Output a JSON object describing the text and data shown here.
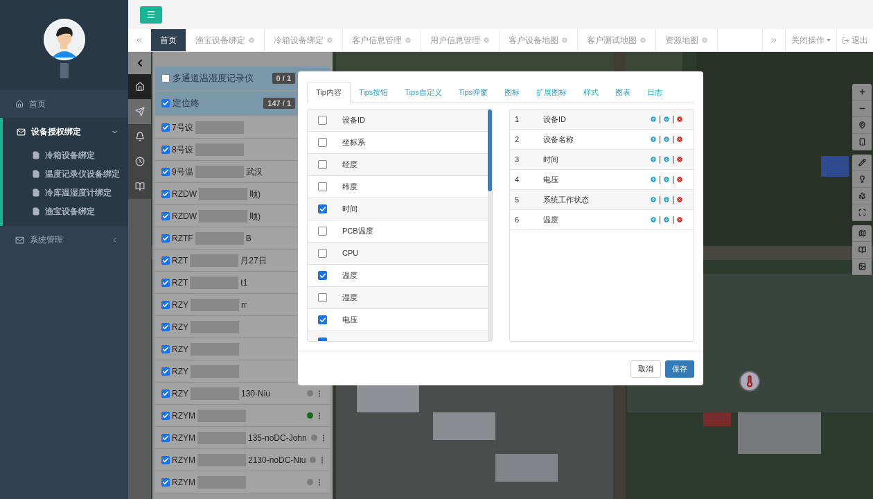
{
  "sidebar": {
    "nav": [
      {
        "label": "首页",
        "kind": "home"
      },
      {
        "label": "设备授权绑定",
        "kind": "group",
        "expanded": true,
        "children": [
          {
            "label": "冷箱设备绑定"
          },
          {
            "label": "温度记录仪设备绑定"
          },
          {
            "label": "冷库温湿度计绑定"
          },
          {
            "label": "渔宝设备绑定"
          }
        ]
      },
      {
        "label": "系统管理",
        "kind": "group",
        "expanded": false
      }
    ]
  },
  "tabs": [
    {
      "label": "首页",
      "selected": true,
      "closable": false
    },
    {
      "label": "渔宝设备绑定",
      "selected": false,
      "closable": true
    },
    {
      "label": "冷箱设备绑定",
      "selected": false,
      "closable": true
    },
    {
      "label": "客户信息管理",
      "selected": false,
      "closable": true
    },
    {
      "label": "用户信息管理",
      "selected": false,
      "closable": true
    },
    {
      "label": "客户设备地图",
      "selected": false,
      "closable": true
    },
    {
      "label": "客户测试地图",
      "selected": false,
      "closable": true
    },
    {
      "label": "资源地图",
      "selected": false,
      "closable": true
    }
  ],
  "tab_actions": {
    "close_menu": "关闭操作",
    "logout": "退出"
  },
  "device_panel": {
    "groups": [
      {
        "label": "多通道温湿度记录仪",
        "checked": false,
        "count": "0 / 1"
      },
      {
        "label": "定位终",
        "checked": true,
        "count": "147 / 1"
      }
    ],
    "items": [
      {
        "prefix": "7号设",
        "checked": true
      },
      {
        "prefix": "8号设",
        "checked": true
      },
      {
        "prefix": "9号温",
        "suffix": "武汉",
        "checked": true
      },
      {
        "prefix": "RZDW",
        "suffix": "顺)",
        "checked": true
      },
      {
        "prefix": "RZDW",
        "suffix": "顺)",
        "checked": true
      },
      {
        "prefix": "RZTF",
        "suffix": "B",
        "checked": true
      },
      {
        "prefix": "RZT",
        "suffix": "月27日",
        "checked": true
      },
      {
        "prefix": "RZT",
        "suffix": "t1",
        "checked": true
      },
      {
        "prefix": "RZY",
        "suffix": "rr",
        "checked": true
      },
      {
        "prefix": "RZY",
        "checked": true
      },
      {
        "prefix": "RZY",
        "checked": true
      },
      {
        "prefix": "RZY",
        "checked": true
      },
      {
        "prefix": "RZY",
        "suffix": "130-Niu",
        "checked": true,
        "color": "#7c7c7c"
      },
      {
        "prefix": "RZYM",
        "checked": true,
        "color": "#0f6e0f"
      },
      {
        "prefix": "RZYM",
        "suffix": "135-noDC-John",
        "checked": true,
        "color": "#7c7c7c"
      },
      {
        "prefix": "RZYM",
        "suffix": "2130-noDC-Niu",
        "checked": true,
        "color": "#7c7c7c"
      },
      {
        "prefix": "RZYM",
        "checked": true,
        "color": "#7c7c7c"
      }
    ]
  },
  "modal": {
    "tabs": [
      {
        "label": "Tip内容",
        "selected": true
      },
      {
        "label": "Tips按钮",
        "selected": false
      },
      {
        "label": "Tips自定义",
        "selected": false
      },
      {
        "label": "Tips弹窗",
        "selected": false
      },
      {
        "label": "图标",
        "selected": false
      },
      {
        "label": "扩展图标",
        "selected": false
      },
      {
        "label": "样式",
        "selected": false
      },
      {
        "label": "图表",
        "selected": false
      },
      {
        "label": "日志",
        "selected": false
      }
    ],
    "fields": [
      {
        "label": "设备ID",
        "checked": false
      },
      {
        "label": "坐标系",
        "checked": false
      },
      {
        "label": "经度",
        "checked": false
      },
      {
        "label": "纬度",
        "checked": false
      },
      {
        "label": "时间",
        "checked": true
      },
      {
        "label": "PCB温度",
        "checked": false
      },
      {
        "label": "CPU",
        "checked": false
      },
      {
        "label": "温度",
        "checked": true
      },
      {
        "label": "湿度",
        "checked": false
      },
      {
        "label": "电压",
        "checked": true
      },
      {
        "checked": true
      }
    ],
    "chosen": [
      {
        "index": "1",
        "label": "设备ID"
      },
      {
        "index": "2",
        "label": "设备名称"
      },
      {
        "index": "3",
        "label": "时间"
      },
      {
        "index": "4",
        "label": "电压"
      },
      {
        "index": "5",
        "label": "系统工作状态"
      },
      {
        "index": "6",
        "label": "温度"
      }
    ],
    "buttons": {
      "cancel": "取消",
      "save": "保存"
    }
  }
}
